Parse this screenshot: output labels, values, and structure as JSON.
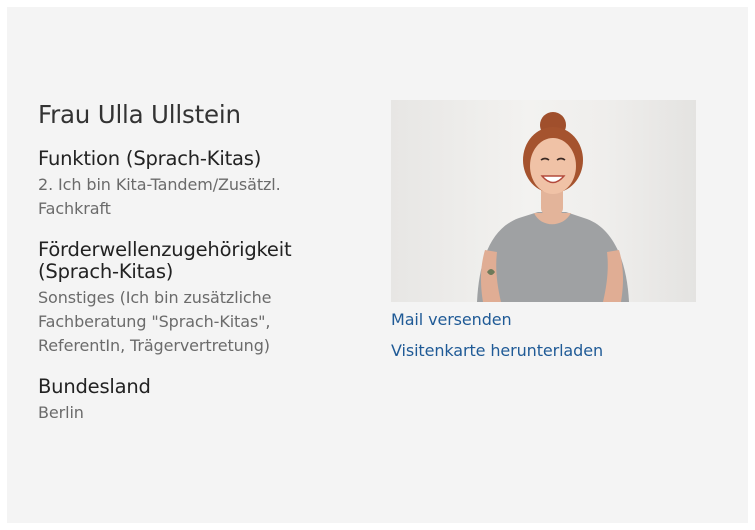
{
  "profile": {
    "name": "Frau Ulla Ullstein",
    "fields": [
      {
        "label": "Funktion (Sprach-Kitas)",
        "value": "2. Ich bin Kita-Tandem/Zusätzl. Fachkraft"
      },
      {
        "label": "Förderwellenzugehörigkeit (Sprach-Kitas)",
        "value": "Sonstiges (Ich bin zusätzliche Fachberatung \"Sprach-Kitas\", ReferentIn, Trägervertretung)"
      },
      {
        "label": "Bundesland",
        "value": "Berlin"
      }
    ]
  },
  "actions": {
    "mail_label": "Mail versenden",
    "vcard_label": "Visitenkarte herunterladen"
  },
  "colors": {
    "card_background": "#f4f4f4",
    "link": "#1f5a96",
    "heading": "#333333",
    "value_text": "#6b6b6b"
  }
}
